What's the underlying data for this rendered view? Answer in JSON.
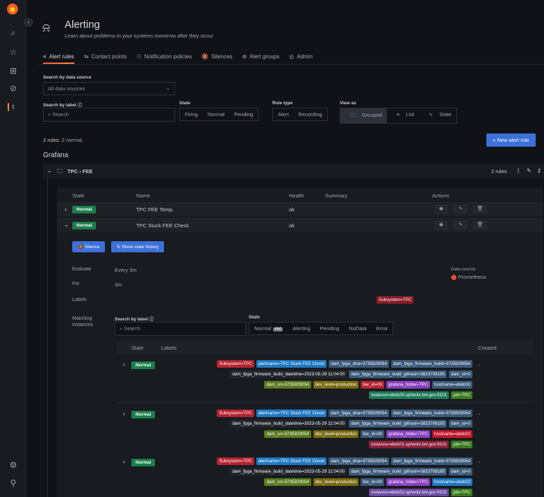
{
  "sidebar": {
    "icons": [
      "grafana-logo",
      "search-icon",
      "star-icon",
      "dashboards-icon",
      "explore-icon",
      "alerting-icon",
      "gear-icon",
      "help-icon"
    ]
  },
  "header": {
    "title": "Alerting",
    "subtitle": "Learn about problems in your systems moments after they occur"
  },
  "tabs": [
    {
      "icon": "≡",
      "label": "Alert rules"
    },
    {
      "icon": "⇆",
      "label": "Contact points"
    },
    {
      "icon": "⚇",
      "label": "Notification policies"
    },
    {
      "icon": "🔕",
      "label": "Silences"
    },
    {
      "icon": "⊛",
      "label": "Alert groups"
    },
    {
      "icon": "◎",
      "label": "Admin"
    }
  ],
  "filters": {
    "datasource_label": "Search by data source",
    "datasource_value": "All data sources",
    "label_search_label": "Search by label",
    "label_search_placeholder": "Search",
    "state_label": "State",
    "state_options": [
      "Firing",
      "Normal",
      "Pending"
    ],
    "rule_type_label": "Rule type",
    "rule_type_options": [
      "Alert",
      "Recording"
    ],
    "view_as_label": "View as",
    "view_as_options": [
      "Grouped",
      "List",
      "State"
    ]
  },
  "summary": {
    "prefix": "2 rules:",
    "detail": " 2 normal"
  },
  "new_rule_button": "+ New alert rule",
  "section_title": "Grafana",
  "folder": {
    "path": "TPC › FEE",
    "count": "2 rules",
    "sep": "|"
  },
  "rules_table": {
    "headers": [
      "State",
      "Name",
      "Health",
      "Summary",
      "Actions"
    ],
    "rows": [
      {
        "state": "Normal",
        "name": "TPC FEE Temp.",
        "health": "ok"
      },
      {
        "state": "Normal",
        "name": "TPC Stuck FEE Check",
        "health": "ok"
      }
    ]
  },
  "detail": {
    "silence_button": "Silence",
    "history_button": "Show state history",
    "evaluate_label": "Evaluate",
    "evaluate_value": "Every 3m",
    "for_label": "For",
    "for_value": "3m",
    "labels_label": "Labels",
    "labels_value": "Subsystem=TPC",
    "datasource_label": "Data source",
    "datasource_value": "Prometheus",
    "matching_label": "Matching",
    "instances_label": "instances",
    "search_label": "Search by label",
    "search_placeholder": "Search",
    "state_label": "State",
    "state_options": [
      "Normal",
      "Alerting",
      "Pending",
      "NoData",
      "Error"
    ],
    "normal_count": "660"
  },
  "instances": {
    "headers": {
      "state": "State",
      "labels": "Labels",
      "created": "Created"
    },
    "dash": "-",
    "rows": [
      {
        "state": "Normal",
        "line1": [
          [
            "Subsystem=TPC",
            "#b4232f"
          ],
          [
            "alertname=TPC Stuck FEE Check",
            "#1f78c1"
          ],
          [
            "dam_fpga_dna=3735929054",
            "#3a5a7a"
          ],
          [
            "dam_fpga_firmware_build=3735929054",
            "#3a5a7a"
          ]
        ],
        "line2": [
          [
            "dam_fpga_firmware_build_datetime=2023-05-29 11:04:00",
            "#22252b"
          ],
          [
            "dam_fpga_firmware_build_githash=3823708185",
            "#3a5a7a"
          ],
          [
            "dam_id=0",
            "#3a5a7a"
          ]
        ],
        "line3": [
          [
            "dam_sn=3735929054",
            "#5a7a1f"
          ],
          [
            "dev_level=production",
            "#7a6a10"
          ],
          [
            "fee_id=00",
            "#b4232f"
          ],
          [
            "grafana_folder=TPC",
            "#8a3fc0"
          ],
          [
            "hostname=ebdc00",
            "#3a5a7a"
          ]
        ],
        "line4": [
          [
            "instance=ebdc00.sphenix.bnl.gov:9101",
            "#1f7a5a"
          ],
          [
            "job=TPC",
            "#3a7a1f"
          ]
        ]
      },
      {
        "state": "Normal",
        "line1": [
          [
            "Subsystem=TPC",
            "#b4232f"
          ],
          [
            "alertname=TPC Stuck FEE Check",
            "#1f78c1"
          ],
          [
            "dam_fpga_dna=3735929054",
            "#3a5a7a"
          ],
          [
            "dam_fpga_firmware_build=3735929054",
            "#3a5a7a"
          ]
        ],
        "line2": [
          [
            "dam_fpga_firmware_build_datetime=2023-05-29 11:04:00",
            "#22252b"
          ],
          [
            "dam_fpga_firmware_build_githash=3823708185",
            "#3a5a7a"
          ],
          [
            "dam_id=0",
            "#3a5a7a"
          ]
        ],
        "line3": [
          [
            "dam_sn=3735929054",
            "#5a7a1f"
          ],
          [
            "dev_level=production",
            "#7a6a10"
          ],
          [
            "fee_id=00",
            "#3a5a7a"
          ],
          [
            "grafana_folder=TPC",
            "#8a3fc0"
          ],
          [
            "hostname=ebdc01",
            "#c4162a"
          ]
        ],
        "line4": [
          [
            "instance=ebdc01.sphenix.bnl.gov:9101",
            "#8a1f3a"
          ],
          [
            "job=TPC",
            "#3a7a1f"
          ]
        ]
      },
      {
        "state": "Normal",
        "line1": [
          [
            "Subsystem=TPC",
            "#b4232f"
          ],
          [
            "alertname=TPC Stuck FEE Check",
            "#1f78c1"
          ],
          [
            "dam_fpga_dna=3735929054",
            "#3a5a7a"
          ],
          [
            "dam_fpga_firmware_build=3735929054",
            "#3a5a7a"
          ]
        ],
        "line2": [
          [
            "dam_fpga_firmware_build_datetime=2023-05-29 11:04:00",
            "#22252b"
          ],
          [
            "dam_fpga_firmware_build_githash=3823708185",
            "#3a5a7a"
          ],
          [
            "dam_id=0",
            "#3a5a7a"
          ]
        ],
        "line3": [
          [
            "dam_sn=3735929054",
            "#5a7a1f"
          ],
          [
            "dev_level=production",
            "#7a6a10"
          ],
          [
            "fee_id=00",
            "#3a5a7a"
          ],
          [
            "grafana_folder=TPC",
            "#8a3fc0"
          ],
          [
            "hostname=ebdc02",
            "#1f78c1"
          ]
        ],
        "line4": [
          [
            "instance=ebdc02.sphenix.bnl.gov:9101",
            "#6a4aa0"
          ],
          [
            "job=TPC",
            "#3a7a1f"
          ]
        ]
      }
    ]
  }
}
